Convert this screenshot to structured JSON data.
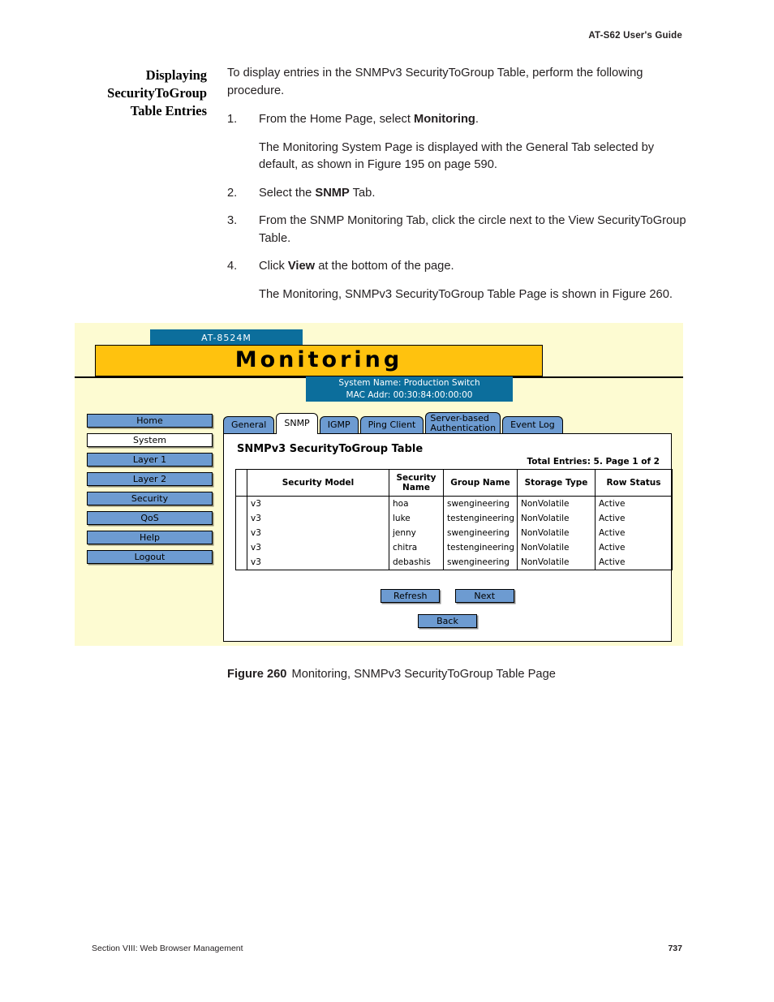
{
  "page": {
    "running_head": "AT-S62  User's Guide",
    "footer_left": "Section VIII: Web Browser Management",
    "footer_page": "737"
  },
  "side_heading": {
    "line1": "Displaying",
    "line2": "SecurityToGroup",
    "line3": "Table Entries"
  },
  "body": {
    "intro_1": "To display entries in the SNMPv3 SecurityToGroup Table, perform the",
    "intro_2": "following procedure.",
    "steps": [
      {
        "num": "1.",
        "text_before": "From the Home Page, select ",
        "bold": "Monitoring",
        "text_after": "."
      },
      {
        "num": "2.",
        "text_before": "Select the ",
        "bold": "SNMP",
        "text_after": " Tab."
      },
      {
        "num": "3.",
        "text_before": "From the SNMP Monitoring Tab, click the circle next to the View SecurityToGroup Table.",
        "bold": "",
        "text_after": ""
      },
      {
        "num": "4.",
        "text_before": "Click ",
        "bold": "View",
        "text_after": " at the bottom of the page."
      }
    ],
    "sub_after_step1": "The Monitoring System Page is displayed with the General Tab selected by default, as shown in Figure 195 on page 590.",
    "sub_after_step4": "The Monitoring, SNMPv3 SecurityToGroup Table Page is shown in Figure 260."
  },
  "figure": {
    "caption_label": "Figure 260",
    "caption_text": "Monitoring, SNMPv3 SecurityToGroup Table Page",
    "device_tab": "AT-8524M",
    "title_banner": "Monitoring",
    "system_name": "System Name: Production Switch",
    "mac_addr": "MAC Addr: 00:30:84:00:00:00",
    "colors": {
      "page_bg": "#fdfbd2",
      "banner_gold": "#ffc20e",
      "deep_blue": "#0c6e9c",
      "button_blue": "#6d9bd1"
    },
    "nav": {
      "items": [
        {
          "label": "Home",
          "selected": false
        },
        {
          "label": "System",
          "selected": true
        },
        {
          "label": "Layer 1",
          "selected": false
        },
        {
          "label": "Layer 2",
          "selected": false
        },
        {
          "label": "Security",
          "selected": false
        },
        {
          "label": "QoS",
          "selected": false
        },
        {
          "label": "Help",
          "selected": false
        },
        {
          "label": "Logout",
          "selected": false
        }
      ]
    },
    "tabs": [
      {
        "label": "General",
        "selected": false
      },
      {
        "label": "SNMP",
        "selected": true
      },
      {
        "label": "IGMP",
        "selected": false
      },
      {
        "label": "Ping Client",
        "selected": false
      },
      {
        "label": "Server-based",
        "label2": "Authentication",
        "selected": false
      },
      {
        "label": "Event Log",
        "selected": false
      }
    ],
    "panel": {
      "title": "SNMPv3 SecurityToGroup Table",
      "entries_line": "Total Entries: 5. Page 1 of 2",
      "columns": [
        "",
        "Security Model",
        "Security Name",
        "Group Name",
        "Storage Type",
        "Row Status"
      ],
      "rows": [
        {
          "select": "",
          "security_model": "v3",
          "security_name": "hoa",
          "group_name": "swengineering",
          "storage_type": "NonVolatile",
          "row_status": "Active"
        },
        {
          "select": "",
          "security_model": "v3",
          "security_name": "luke",
          "group_name": "testengineering",
          "storage_type": "NonVolatile",
          "row_status": "Active"
        },
        {
          "select": "",
          "security_model": "v3",
          "security_name": "jenny",
          "group_name": "swengineering",
          "storage_type": "NonVolatile",
          "row_status": "Active"
        },
        {
          "select": "",
          "security_model": "v3",
          "security_name": "chitra",
          "group_name": "testengineering",
          "storage_type": "NonVolatile",
          "row_status": "Active"
        },
        {
          "select": "",
          "security_model": "v3",
          "security_name": "debashis",
          "group_name": "swengineering",
          "storage_type": "NonVolatile",
          "row_status": "Active"
        }
      ],
      "buttons": {
        "refresh": "Refresh",
        "next": "Next",
        "back": "Back"
      }
    }
  }
}
